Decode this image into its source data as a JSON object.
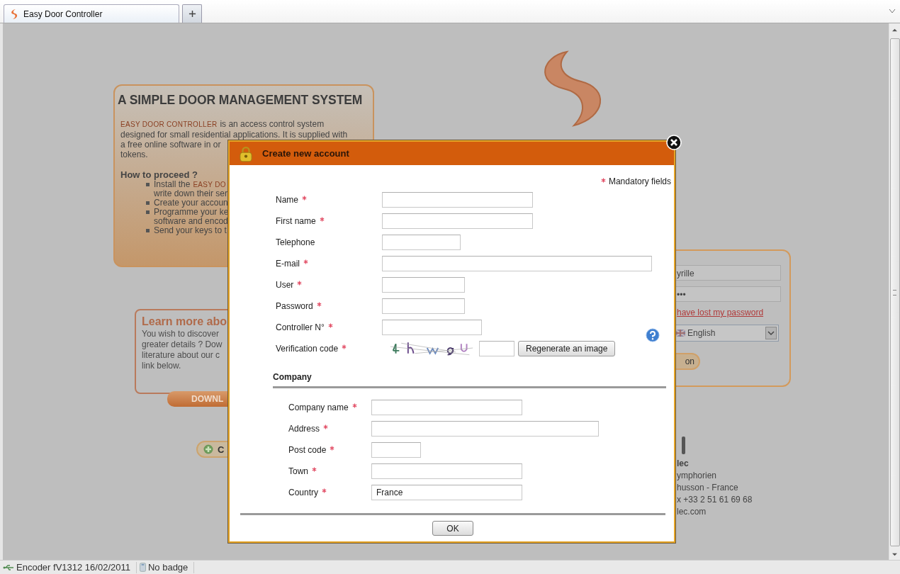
{
  "browser": {
    "tabs": [
      {
        "title": "Easy Door Controller",
        "selected": true
      }
    ]
  },
  "page": {
    "intro_panel": {
      "title": "A SIMPLE DOOR MANAGEMENT SYSTEM",
      "intro_lines": [
        [
          {
            "kind": "brand",
            "text": "EASY DOOR CONTROLLER"
          },
          {
            "kind": "plain",
            "text": "is an access control system"
          }
        ],
        [
          {
            "kind": "plain",
            "text": "designed for small residential applications. It is supplied with"
          }
        ],
        [
          {
            "kind": "plain",
            "text": "a free online software in or"
          }
        ],
        [
          {
            "kind": "plain",
            "text": "tokens."
          }
        ]
      ],
      "subtitle": "How to proceed ?",
      "steps": [
        {
          "lines": [
            [
              {
                "kind": "plain",
                "text": "Install the"
              },
              {
                "kind": "brand",
                "text": "EASY DO"
              }
            ],
            [
              {
                "kind": "plain",
                "text": "write down their ser"
              }
            ]
          ]
        },
        {
          "lines": [
            [
              {
                "kind": "plain",
                "text": "Create your accoun"
              }
            ]
          ]
        },
        {
          "lines": [
            [
              {
                "kind": "plain",
                "text": "Programme your ke"
              }
            ],
            [
              {
                "kind": "plain",
                "text": "software and encod"
              }
            ]
          ]
        },
        {
          "lines": [
            [
              {
                "kind": "plain",
                "text": "Send your keys to t"
              }
            ]
          ]
        }
      ]
    },
    "learn_panel": {
      "title": "Learn more abo",
      "lines": [
        "You wish to discover",
        "greater details ? Dow",
        "literature about our c",
        "link below."
      ],
      "button": "DOWNL"
    },
    "create_button": "C",
    "login_panel": {
      "user": "yrille",
      "password": "•••",
      "forgot_link": "have lost my password",
      "language": "English",
      "button": "on"
    },
    "address_lines": [
      {
        "text": "lec",
        "bold": true
      },
      {
        "text": "ymphorien",
        "bold": false
      },
      {
        "text": "husson - France",
        "bold": false
      },
      {
        "text": "x +33 2 51 61 69 68",
        "bold": false
      },
      {
        "text": "lec.com",
        "bold": false
      }
    ]
  },
  "dialog": {
    "title": "Create new account",
    "mandatory_note": "Mandatory fields",
    "fields": [
      {
        "kind": "text",
        "label": "Name",
        "required": true,
        "help": false
      },
      {
        "kind": "text",
        "label": "First name",
        "required": true,
        "help": false
      },
      {
        "kind": "text",
        "label": "Telephone",
        "required": false,
        "help": false
      },
      {
        "kind": "text",
        "label": "E-mail",
        "required": true,
        "help": false
      },
      {
        "kind": "text",
        "label": "User",
        "required": true,
        "help": false
      },
      {
        "kind": "text",
        "label": "Password",
        "required": true,
        "help": false
      },
      {
        "kind": "text",
        "label": "Controller N°",
        "required": true,
        "help": true
      },
      {
        "kind": "captcha",
        "label": "Verification code",
        "required": true,
        "help": false,
        "button": "Regenerate an image"
      }
    ],
    "company_section": {
      "title": "Company",
      "fields": [
        {
          "label": "Company name",
          "required": true
        },
        {
          "label": "Address",
          "required": true
        },
        {
          "label": "Post code",
          "required": true
        },
        {
          "label": "Town",
          "required": true
        },
        {
          "label": "Country",
          "required": true,
          "value": "France"
        }
      ]
    },
    "ok_button": "OK"
  },
  "status_bar": {
    "encoder": "Encoder fV1312 16/02/2011",
    "badge": "No badge"
  }
}
